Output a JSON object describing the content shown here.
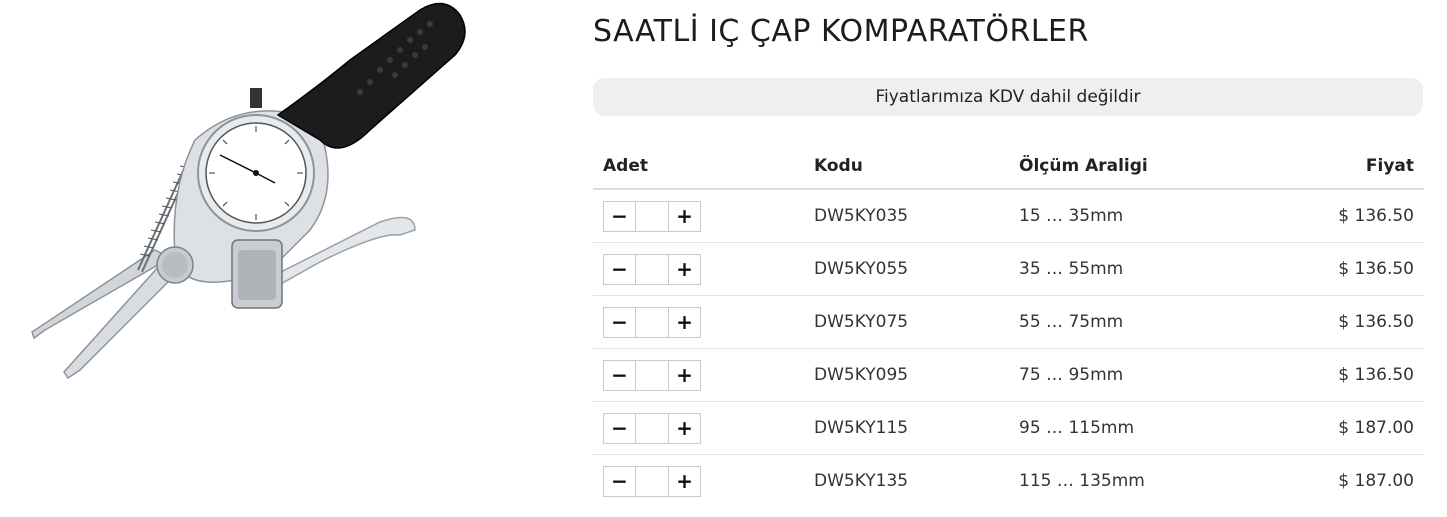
{
  "product": {
    "title": "SAATLİ IÇ ÇAP KOMPARATÖRLER",
    "image_icon": "dial-bore-caliper-gauge-image"
  },
  "notice": {
    "text": "Fiyatlarımıza KDV dahil değildir"
  },
  "table": {
    "headers": {
      "adet": "Adet",
      "kodu": "Kodu",
      "range": "Ölçüm Araligi",
      "price": "Fiyat"
    },
    "rows": [
      {
        "qty": "",
        "code": "DW5KY035",
        "range": "15 … 35mm",
        "price": "$ 136.50"
      },
      {
        "qty": "",
        "code": "DW5KY055",
        "range": "35 … 55mm",
        "price": "$ 136.50"
      },
      {
        "qty": "",
        "code": "DW5KY075",
        "range": "55 … 75mm",
        "price": "$ 136.50"
      },
      {
        "qty": "",
        "code": "DW5KY095",
        "range": "75 … 95mm",
        "price": "$ 136.50"
      },
      {
        "qty": "",
        "code": "DW5KY115",
        "range": "95 … 115mm",
        "price": "$ 187.00"
      },
      {
        "qty": "",
        "code": "DW5KY135",
        "range": "115 … 135mm",
        "price": "$ 187.00"
      }
    ],
    "minus_label": "−",
    "plus_label": "+"
  }
}
